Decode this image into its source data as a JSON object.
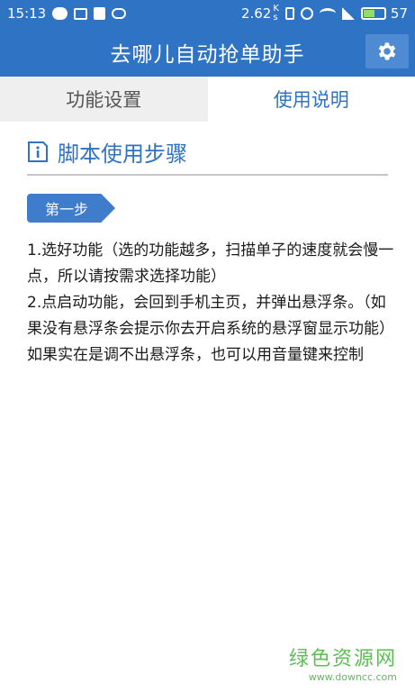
{
  "status_bar": {
    "time": "15:13",
    "net_speed": "2.62",
    "net_unit_top": "K",
    "net_unit_bottom": "s",
    "battery_level": "57",
    "battery_fraction": 0.57,
    "battery_color": "#8ee06a"
  },
  "header": {
    "title": "去哪儿自动抢单助手",
    "background": "#2f73c4"
  },
  "tabs": [
    {
      "label": "功能设置",
      "active": false
    },
    {
      "label": "使用说明",
      "active": true
    }
  ],
  "section": {
    "title": "脚本使用步骤",
    "icon": "info-icon"
  },
  "step": {
    "label": "第一步"
  },
  "instructions": [
    "1.选好功能（选的功能越多，扫描单子的速度就会慢一点，所以请按需求选择功能）",
    "2.点启动功能，会回到手机主页，并弹出悬浮条。（如果没有悬浮条会提示你去开启系统的悬浮窗显示功能）如果实在是调不出悬浮条，也可以用音量键来控制"
  ],
  "watermark": {
    "name": "绿色资源网",
    "url": "www.downcc.com"
  }
}
